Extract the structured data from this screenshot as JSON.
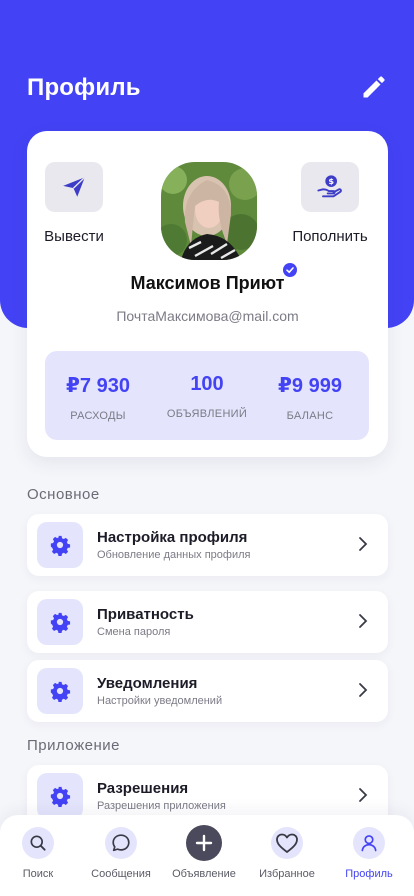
{
  "header": {
    "title": "Профиль",
    "edit_icon": "pencil-icon"
  },
  "colors": {
    "accent": "#4343f5",
    "accent_soft": "#e4e5fc",
    "background": "#f5f6fa"
  },
  "profile": {
    "name": "Максимов Приют",
    "email": "ПочтаМаксимова@mail.com",
    "verified": true,
    "actions": [
      {
        "label": "Вывести",
        "icon": "paper-plane-icon"
      },
      {
        "label": "Пополнить",
        "icon": "hand-coin-icon"
      }
    ],
    "stats": [
      {
        "value": "₽7 930",
        "label": "РАСХОДЫ"
      },
      {
        "value": "100",
        "label": "ОБЪЯВЛЕНИЙ"
      },
      {
        "value": "₽9 999",
        "label": "БАЛАНС"
      }
    ]
  },
  "sections": [
    {
      "title": "Основное",
      "items": [
        {
          "title": "Настройка профиля",
          "subtitle": "Обновление данных профиля",
          "icon": "gear-icon"
        },
        {
          "title": "Приватность",
          "subtitle": "Смена пароля",
          "icon": "gear-icon"
        },
        {
          "title": "Уведомления",
          "subtitle": "Настройки уведомлений",
          "icon": "gear-icon"
        }
      ]
    },
    {
      "title": "Приложение",
      "items": [
        {
          "title": "Разрешения",
          "subtitle": "Разрешения приложения",
          "icon": "gear-icon"
        }
      ]
    }
  ],
  "tabbar": {
    "active": "Профиль",
    "tabs": [
      {
        "label": "Поиск",
        "icon": "search-icon"
      },
      {
        "label": "Сообщения",
        "icon": "chat-icon"
      },
      {
        "label": "Объявление",
        "icon": "plus-icon"
      },
      {
        "label": "Избранное",
        "icon": "heart-icon"
      },
      {
        "label": "Профиль",
        "icon": "user-icon"
      }
    ]
  }
}
